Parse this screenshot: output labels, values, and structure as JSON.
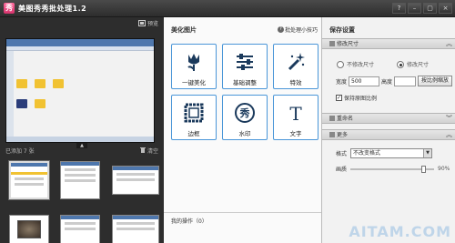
{
  "window": {
    "title": "美图秀秀批处理1.2",
    "app_icon": "秀",
    "buttons": [
      "?",
      "–",
      "▢",
      "×"
    ]
  },
  "left": {
    "preview_label": "预览",
    "collapse_arrow": "▲",
    "added_count_label": "已添加 7 张",
    "clear_label": "清空"
  },
  "middle": {
    "title": "美化图片",
    "tips_label": "批处理小技巧",
    "tiles": [
      {
        "label": "一键美化",
        "icon": "tulip-icon"
      },
      {
        "label": "基础调整",
        "icon": "sliders-icon"
      },
      {
        "label": "特效",
        "icon": "magic-wand-icon"
      },
      {
        "label": "边框",
        "icon": "frame-icon"
      },
      {
        "label": "水印",
        "icon": "watermark-icon",
        "glyph": "秀"
      },
      {
        "label": "文字",
        "icon": "text-icon",
        "glyph": "T"
      }
    ],
    "ops_label": "我的操作（0）"
  },
  "right": {
    "title": "保存设置",
    "resize_section": "修改尺寸",
    "radio_keep": "不修改尺寸",
    "radio_change": "修改尺寸",
    "width_label": "宽度",
    "width_value": "500",
    "height_label": "高度",
    "scale_button": "按比例缩放",
    "keep_ratio_label": "保持原图比例",
    "rename_section": "重命名",
    "more_section": "更多",
    "format_label": "格式",
    "format_value": "不改变格式",
    "quality_label": "画质",
    "quality_value": "90%",
    "quality_fraction": 0.9
  },
  "watermark_text": "AITAM.COM",
  "colors": {
    "accent": "#4a96d8",
    "title_bg": "#3a3a3a",
    "panel_dark": "#2d2d2d"
  }
}
